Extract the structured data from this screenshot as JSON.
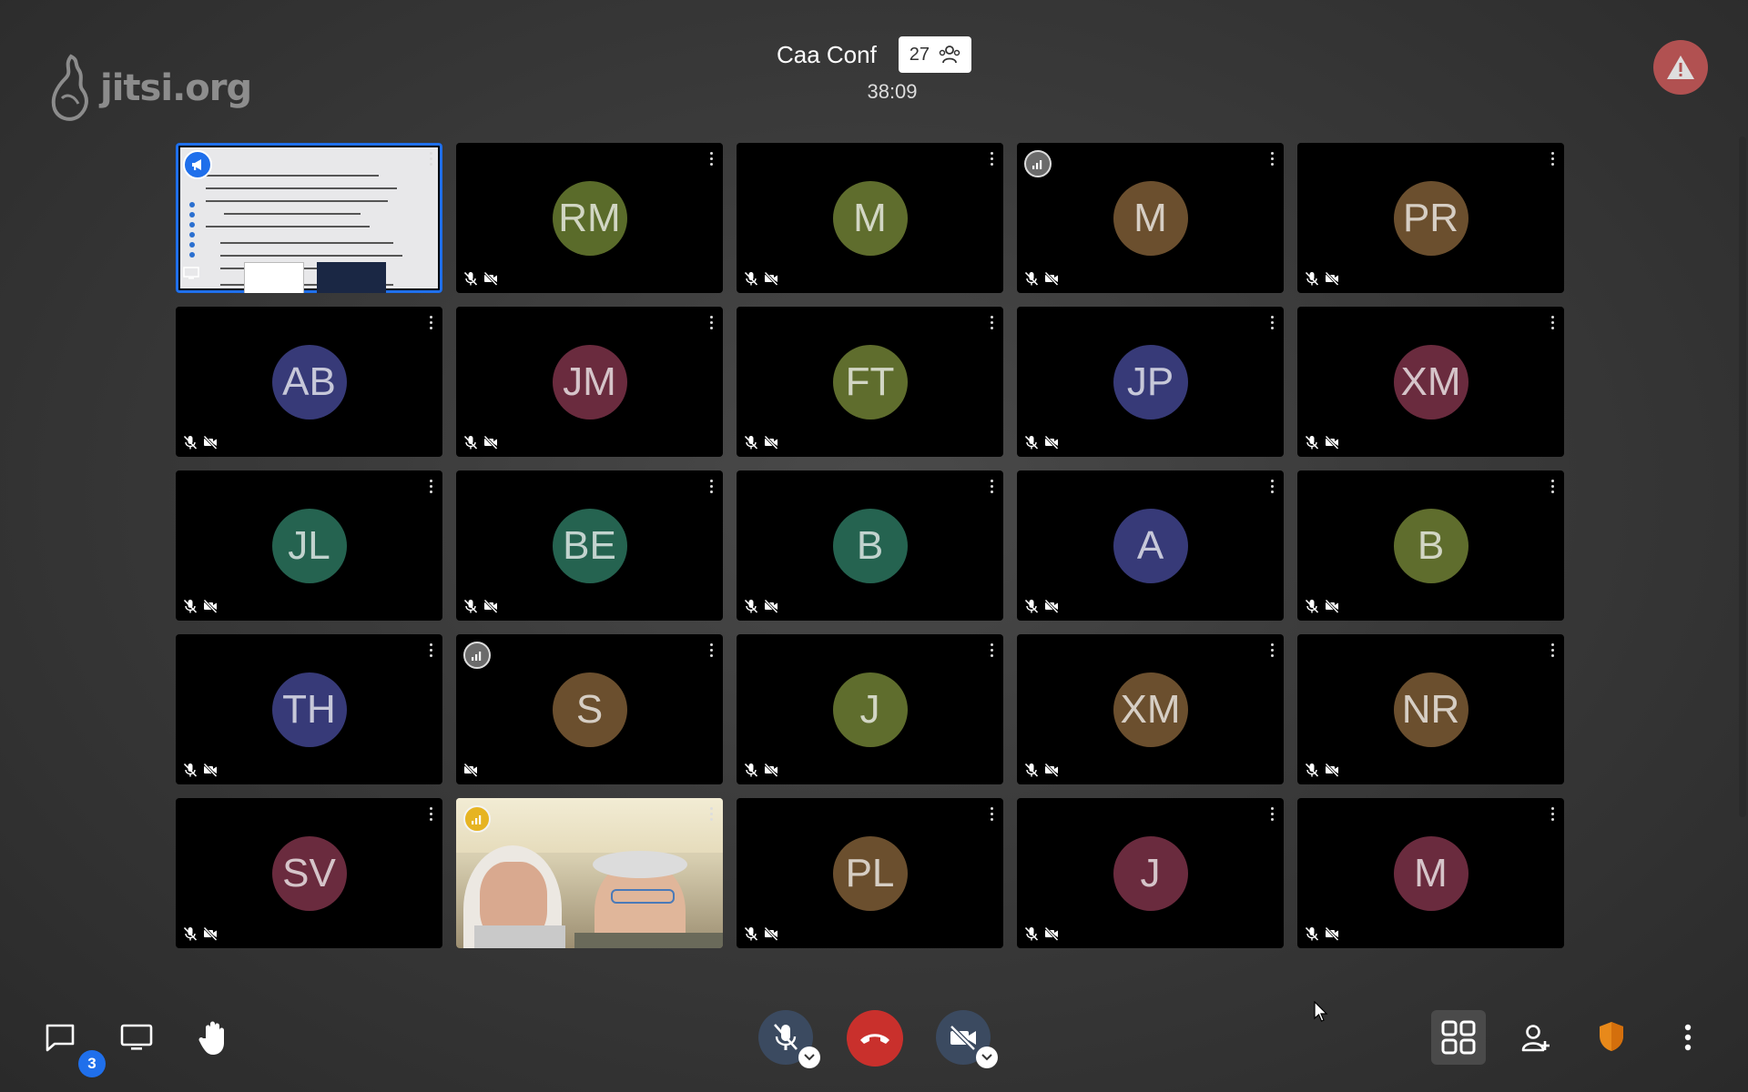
{
  "logo": {
    "text": "jitsi.org"
  },
  "header": {
    "title": "Caa Conf",
    "participant_count": "27",
    "timer": "38:09"
  },
  "colors": {
    "accent": "#1f6feb",
    "hangup": "#c9302c",
    "warning": "#c05555",
    "connection_good": "#e6b422",
    "badge": "#1f6feb"
  },
  "tiles": [
    {
      "type": "screenshare",
      "initials": "",
      "color": ""
    },
    {
      "type": "avatar",
      "initials": "RM",
      "color": "#5a6b2a"
    },
    {
      "type": "avatar",
      "initials": "M",
      "color": "#5f6d2d"
    },
    {
      "type": "avatar",
      "initials": "M",
      "color": "#6b4f2e",
      "connection": "poor"
    },
    {
      "type": "avatar",
      "initials": "PR",
      "color": "#6b4f2e"
    },
    {
      "type": "avatar",
      "initials": "AB",
      "color": "#373a78"
    },
    {
      "type": "avatar",
      "initials": "JM",
      "color": "#6a2b3e"
    },
    {
      "type": "avatar",
      "initials": "FT",
      "color": "#5f6d2d"
    },
    {
      "type": "avatar",
      "initials": "JP",
      "color": "#373a78"
    },
    {
      "type": "avatar",
      "initials": "XM",
      "color": "#6a2b3e"
    },
    {
      "type": "avatar",
      "initials": "JL",
      "color": "#256350"
    },
    {
      "type": "avatar",
      "initials": "BE",
      "color": "#256350"
    },
    {
      "type": "avatar",
      "initials": "B",
      "color": "#256350"
    },
    {
      "type": "avatar",
      "initials": "A",
      "color": "#373a78"
    },
    {
      "type": "avatar",
      "initials": "B",
      "color": "#5f6d2d"
    },
    {
      "type": "avatar",
      "initials": "TH",
      "color": "#373a78"
    },
    {
      "type": "avatar",
      "initials": "S",
      "color": "#6b4f2e",
      "connection": "poor",
      "mic_visible": false
    },
    {
      "type": "avatar",
      "initials": "J",
      "color": "#5f6d2d"
    },
    {
      "type": "avatar",
      "initials": "XM",
      "color": "#6b4f2e"
    },
    {
      "type": "avatar",
      "initials": "NR",
      "color": "#6b4f2e"
    },
    {
      "type": "avatar",
      "initials": "SV",
      "color": "#6a2b3e"
    },
    {
      "type": "video",
      "initials": "",
      "color": "",
      "connection": "good"
    },
    {
      "type": "avatar",
      "initials": "PL",
      "color": "#6b4f2e"
    },
    {
      "type": "avatar",
      "initials": "J",
      "color": "#6a2b3e"
    },
    {
      "type": "avatar",
      "initials": "M",
      "color": "#6a2b3e"
    }
  ],
  "toolbar": {
    "chat_unread": "3"
  }
}
